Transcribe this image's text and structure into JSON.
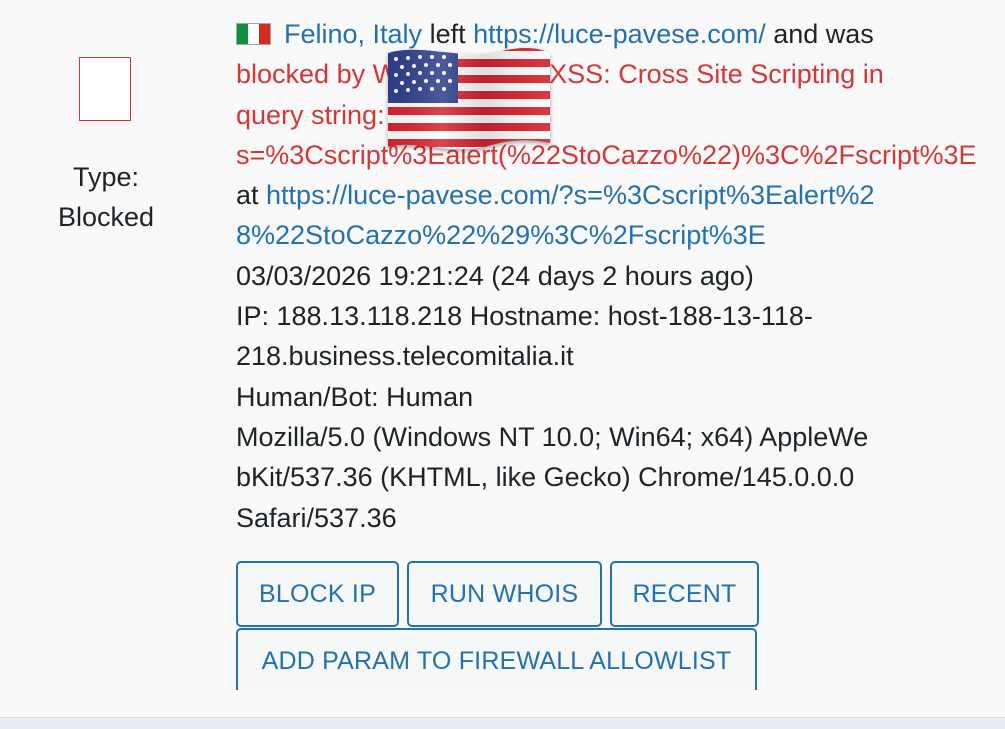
{
  "record": {
    "type_label": "Type:",
    "type_value": "Blocked",
    "location": "Felino, Italy",
    "left_word": " left ",
    "site_url": "https://luce-pavese.com/",
    "and_was": " and was",
    "blocked_line1": "blocked by Wordfence for XSS: Cross Site Scripting in",
    "blocked_line2": "query string:",
    "blocked_line3": "s=%3Cscript%3Ealert(%22StoCazzo%22)%3C%2Fscript%3E",
    "at_word": "at ",
    "request_url_line1": "https://luce-pavese.com/?s=%3Cscript%3Ealert%2",
    "request_url_line2": "8%22StoCazzo%22%29%3C%2Fscript%3E",
    "timestamp": "03/03/2026 19:21:24 (24 days 2 hours ago)",
    "ip_line1": "IP: 188.13.118.218 Hostname: host-188-13-118-",
    "ip_line2": "218.business.telecomitalia.it",
    "human_bot": "Human/Bot: Human",
    "ua_line1": "Mozilla/5.0 (Windows NT 10.0; Win64; x64) AppleWe",
    "ua_line2": "bKit/537.36 (KHTML, like Gecko) Chrome/145.0.0.0",
    "ua_line3": "Safari/537.36"
  },
  "icons": {
    "country_flag": "italy-flag-icon",
    "overlay_flag": "us-flag-icon"
  },
  "buttons": {
    "block_ip": "BLOCK IP",
    "run_whois": "RUN WHOIS",
    "recent": "RECENT",
    "add_param": "ADD PARAM TO FIREWALL ALLOWLIST"
  },
  "colors": {
    "link": "#2271b1",
    "blocked_red": "#d63638",
    "text": "#1d2327",
    "background": "#f9f9f9"
  }
}
